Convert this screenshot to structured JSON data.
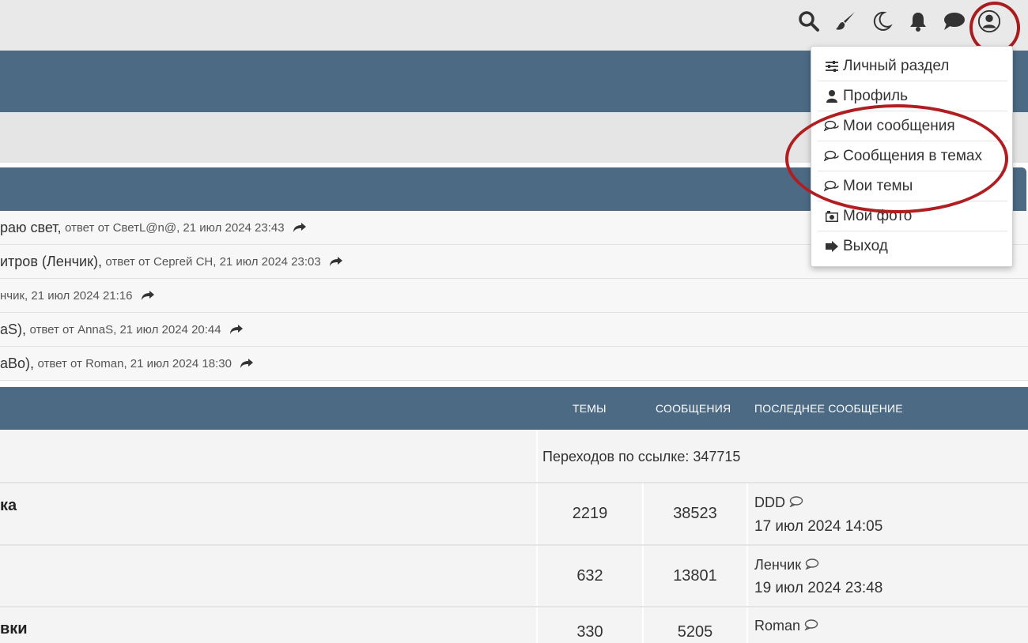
{
  "colors": {
    "header_blue": "#4c6a84",
    "annotation_red": "#b01e22"
  },
  "top_icons": [
    "search-icon",
    "brush-icon",
    "moon-icon",
    "bell-icon",
    "chat-icon",
    "user-icon"
  ],
  "activity": [
    {
      "title": "раю свет,",
      "meta": "ответ от СветL@n@, 21 июл 2024 23:43"
    },
    {
      "title": "итров (Ленчик),",
      "meta": "ответ от Сергей СН, 21 июл 2024 23:03"
    },
    {
      "title": "",
      "meta": "нчик, 21 июл 2024 21:16"
    },
    {
      "title": "aS),",
      "meta": "ответ от AnnaS, 21 июл 2024 20:44"
    },
    {
      "title": "aBo),",
      "meta": "ответ от Roman, 21 июл 2024 18:30"
    }
  ],
  "forum_table": {
    "col_topics": "ТЕМЫ",
    "col_posts": "СООБЩЕНИЯ",
    "col_last": "ПОСЛЕДНЕЕ СООБЩЕНИЕ",
    "redirect": "Переходов по ссылке: 347715",
    "rows": [
      {
        "name": "ка",
        "topics": "2219",
        "posts": "38523",
        "last_user": "DDD",
        "last_date": "17 июл 2024 14:05"
      },
      {
        "name": "",
        "topics": "632",
        "posts": "13801",
        "last_user": "Ленчик",
        "last_date": "19 июл 2024 23:48"
      },
      {
        "name": "вки",
        "topics": "330",
        "posts": "5205",
        "last_user": "Roman",
        "last_date": ""
      }
    ]
  },
  "dropdown": {
    "items": [
      {
        "label": "Личный раздел",
        "icon": "sliders-icon"
      },
      {
        "label": "Профиль",
        "icon": "person-icon"
      },
      {
        "label": "Мои сообщения",
        "icon": "comments-icon"
      },
      {
        "label": "Сообщения в темах",
        "icon": "comments-icon"
      },
      {
        "label": "Мои темы",
        "icon": "comments-icon"
      },
      {
        "label": "Мои фото",
        "icon": "camera-icon"
      },
      {
        "label": "Выход",
        "icon": "logout-icon"
      }
    ]
  }
}
